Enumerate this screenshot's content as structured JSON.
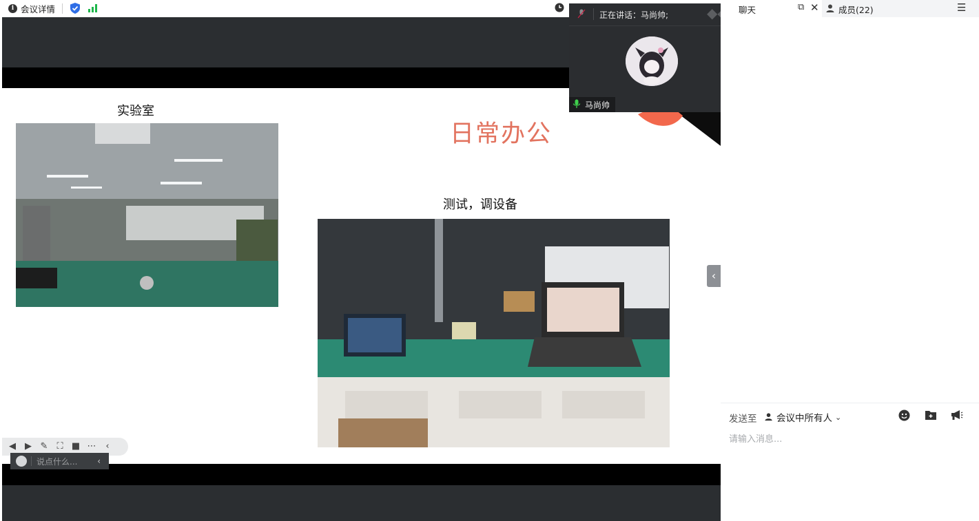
{
  "topbar": {
    "meeting_details": "会议详情"
  },
  "slide": {
    "title_lab": "实验室",
    "title_daily": "日常办公",
    "title_test": "测试，调设备"
  },
  "speaker": {
    "speaking_now": "正在讲话：马尚帅;",
    "name": "马尚帅"
  },
  "right_panel": {
    "chat_tab": "聊天",
    "members_tab": "成员(22)",
    "send_to_label": "发送至",
    "send_to_target": "会议中所有人",
    "message_placeholder": "请输入消息..."
  },
  "floating": {
    "say_placeholder": "说点什么..."
  },
  "icons": {
    "info": "info-icon",
    "shield": "shield-icon",
    "signal": "signal-icon",
    "close": "close-icon",
    "popout": "popout-icon",
    "member": "member-icon",
    "menu": "menu-icon",
    "emoji": "emoji-icon",
    "folder": "folder-icon",
    "announce": "announce-icon",
    "mic": "mic-icon"
  },
  "colors": {
    "accent_blue": "#2f6ee6",
    "signal_green": "#1db64a",
    "title_coral": "#e2735f",
    "mic_green": "#3fcf4d"
  }
}
